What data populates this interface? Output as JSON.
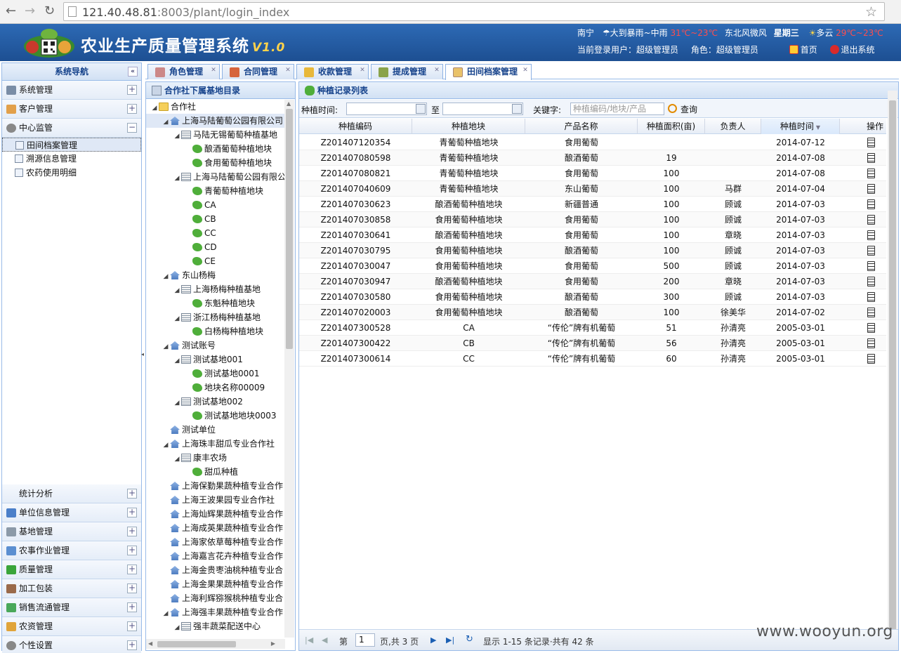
{
  "browser": {
    "url_host": "121.40.48.81",
    "url_rest": ":8003/plant/login_index"
  },
  "header": {
    "title": "农业生产质量管理系统",
    "version": "V1.0",
    "weather": {
      "city": "南宁",
      "today_desc": "大到暴雨~中雨",
      "today_temp": "31℃~23℃",
      "wind": "东北风微风",
      "weekday": "星期三",
      "next_desc": "多云",
      "next_temp": "29℃~23℃"
    },
    "current_user": "当前登录用户：超级管理员",
    "role": "角色：超级管理员",
    "home": "首页",
    "logout": "退出系统"
  },
  "nav": {
    "title": "系统导航",
    "top_items": [
      {
        "label": "系统管理",
        "icon": "monitor-icon"
      },
      {
        "label": "客户管理",
        "icon": "users-icon"
      },
      {
        "label": "中心监管",
        "icon": "camera-icon"
      }
    ],
    "sub_items": [
      {
        "label": "田间档案管理",
        "icon": "document-icon"
      },
      {
        "label": "溯源信息管理",
        "icon": "list-icon"
      },
      {
        "label": "农药使用明细",
        "icon": "list-icon"
      }
    ],
    "bottom_items": [
      {
        "label": "统计分析"
      },
      {
        "label": "单位信息管理"
      },
      {
        "label": "基地管理"
      },
      {
        "label": "农事作业管理"
      },
      {
        "label": "质量管理"
      },
      {
        "label": "加工包装"
      },
      {
        "label": "销售流通管理"
      },
      {
        "label": "农资管理"
      },
      {
        "label": "个性设置"
      }
    ]
  },
  "tabs": [
    "角色管理",
    "合同管理",
    "收款管理",
    "提成管理",
    "田间档案管理"
  ],
  "tree": {
    "title": "合作社下属基地目录",
    "nodes": [
      "合作社",
      "上海马陆葡萄公园有限公司",
      "马陆无锡葡萄种植基地",
      "酿酒葡萄种植地块",
      "食用葡萄种植地块",
      "上海马陆葡萄公园有限公",
      "青葡萄种植地块",
      "CA",
      "CB",
      "CC",
      "CD",
      "CE",
      "东山杨梅",
      "上海杨梅种植基地",
      "东魁种植地块",
      "浙江杨梅种植基地",
      "白杨梅种植地块",
      "测试账号",
      "测试基地001",
      "测试基地0001",
      "地块名称00009",
      "测试基地002",
      "测试基地地块0003",
      "测试单位",
      "上海珠丰甜瓜专业合作社",
      "康丰农场",
      "甜瓜种植",
      "上海保勤果蔬种植专业合作",
      "上海王波果园专业合作社",
      "上海灿辉果蔬种植专业合作",
      "上海成英果蔬种植专业合作",
      "上海家依草莓种植专业合作",
      "上海嘉言花卉种植专业合作",
      "上海金贵枣油桃种植专业合",
      "上海金果果蔬种植专业合作",
      "上海利辉猕猴桃种植专业合",
      "上海强丰果蔬种植专业合作",
      "强丰蔬菜配送中心"
    ]
  },
  "grid": {
    "title": "种植记录列表",
    "search": {
      "time_label": "种植时间:",
      "to_label": "至",
      "keyword_label": "关键字:",
      "keyword_placeholder": "种植编码/地块/产品",
      "query": "查询"
    },
    "columns": [
      "种植编码",
      "种植地块",
      "产品名称",
      "种植面积(亩)",
      "负责人",
      "种植时间",
      "操作"
    ],
    "rows": [
      [
        "Z201407120354",
        "青葡萄种植地块",
        "食用葡萄",
        "",
        "",
        "2014-07-12"
      ],
      [
        "Z201407080598",
        "青葡萄种植地块",
        "酿酒葡萄",
        "19",
        "",
        "2014-07-08"
      ],
      [
        "Z201407080821",
        "青葡萄种植地块",
        "食用葡萄",
        "100",
        "",
        "2014-07-08"
      ],
      [
        "Z201407040609",
        "青葡萄种植地块",
        "东山葡萄",
        "100",
        "马群",
        "2014-07-04"
      ],
      [
        "Z201407030623",
        "酿酒葡萄种植地块",
        "新疆普通",
        "100",
        "顾诚",
        "2014-07-03"
      ],
      [
        "Z201407030858",
        "食用葡萄种植地块",
        "食用葡萄",
        "100",
        "顾诚",
        "2014-07-03"
      ],
      [
        "Z201407030641",
        "酿酒葡萄种植地块",
        "食用葡萄",
        "100",
        "章晓",
        "2014-07-03"
      ],
      [
        "Z201407030795",
        "食用葡萄种植地块",
        "酿酒葡萄",
        "100",
        "顾诚",
        "2014-07-03"
      ],
      [
        "Z201407030047",
        "食用葡萄种植地块",
        "食用葡萄",
        "500",
        "顾诚",
        "2014-07-03"
      ],
      [
        "Z201407030947",
        "酿酒葡萄种植地块",
        "食用葡萄",
        "200",
        "章晓",
        "2014-07-03"
      ],
      [
        "Z201407030580",
        "食用葡萄种植地块",
        "酿酒葡萄",
        "300",
        "顾诚",
        "2014-07-03"
      ],
      [
        "Z201407020003",
        "食用葡萄种植地块",
        "酿酒葡萄",
        "100",
        "徐美华",
        "2014-07-02"
      ],
      [
        "Z201407300528",
        "CA",
        "“传伦”牌有机葡萄",
        "51",
        "孙清亮",
        "2005-03-01"
      ],
      [
        "Z201407300422",
        "CB",
        "“传伦”牌有机葡萄",
        "56",
        "孙清亮",
        "2005-03-01"
      ],
      [
        "Z201407300614",
        "CC",
        "“传伦”牌有机葡萄",
        "60",
        "孙清亮",
        "2005-03-01"
      ]
    ],
    "pager": {
      "page_prefix": "第",
      "page": "1",
      "page_suffix": "页,共 3 页",
      "summary": "显示 1-15 条记录·共有 42 条"
    }
  },
  "watermark": "www.wooyun.org",
  "colors": {
    "header": "#2a62ad",
    "panel_title": "#15428b",
    "accent_red": "#ff4d4d"
  }
}
